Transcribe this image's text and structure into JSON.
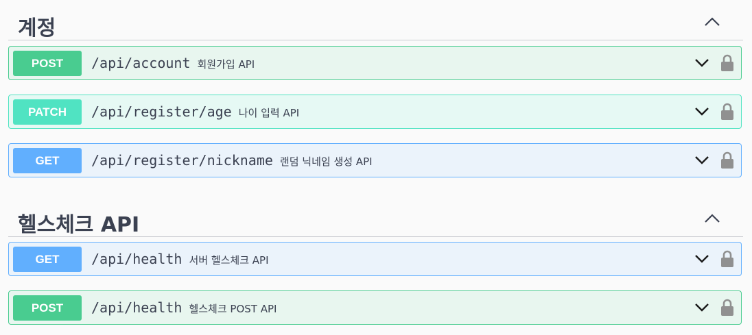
{
  "sections": [
    {
      "title": "계정",
      "operations": [
        {
          "method": "POST",
          "path": "/api/account",
          "summary": "회원가입 API"
        },
        {
          "method": "PATCH",
          "path": "/api/register/age",
          "summary": "나이 입력 API"
        },
        {
          "method": "GET",
          "path": "/api/register/nickname",
          "summary": "랜덤 닉네임 생성 API"
        }
      ]
    },
    {
      "title": "헬스체크 API",
      "operations": [
        {
          "method": "GET",
          "path": "/api/health",
          "summary": "서버 헬스체크 API"
        },
        {
          "method": "POST",
          "path": "/api/health",
          "summary": "헬스체크 POST API"
        }
      ]
    }
  ],
  "colors": {
    "post": "#49cc90",
    "patch": "#50e3c2",
    "get": "#61affe",
    "text": "#3b4151"
  },
  "icons": {
    "collapse": "chevron-up-icon",
    "expand": "chevron-down-icon",
    "auth": "lock-icon"
  }
}
